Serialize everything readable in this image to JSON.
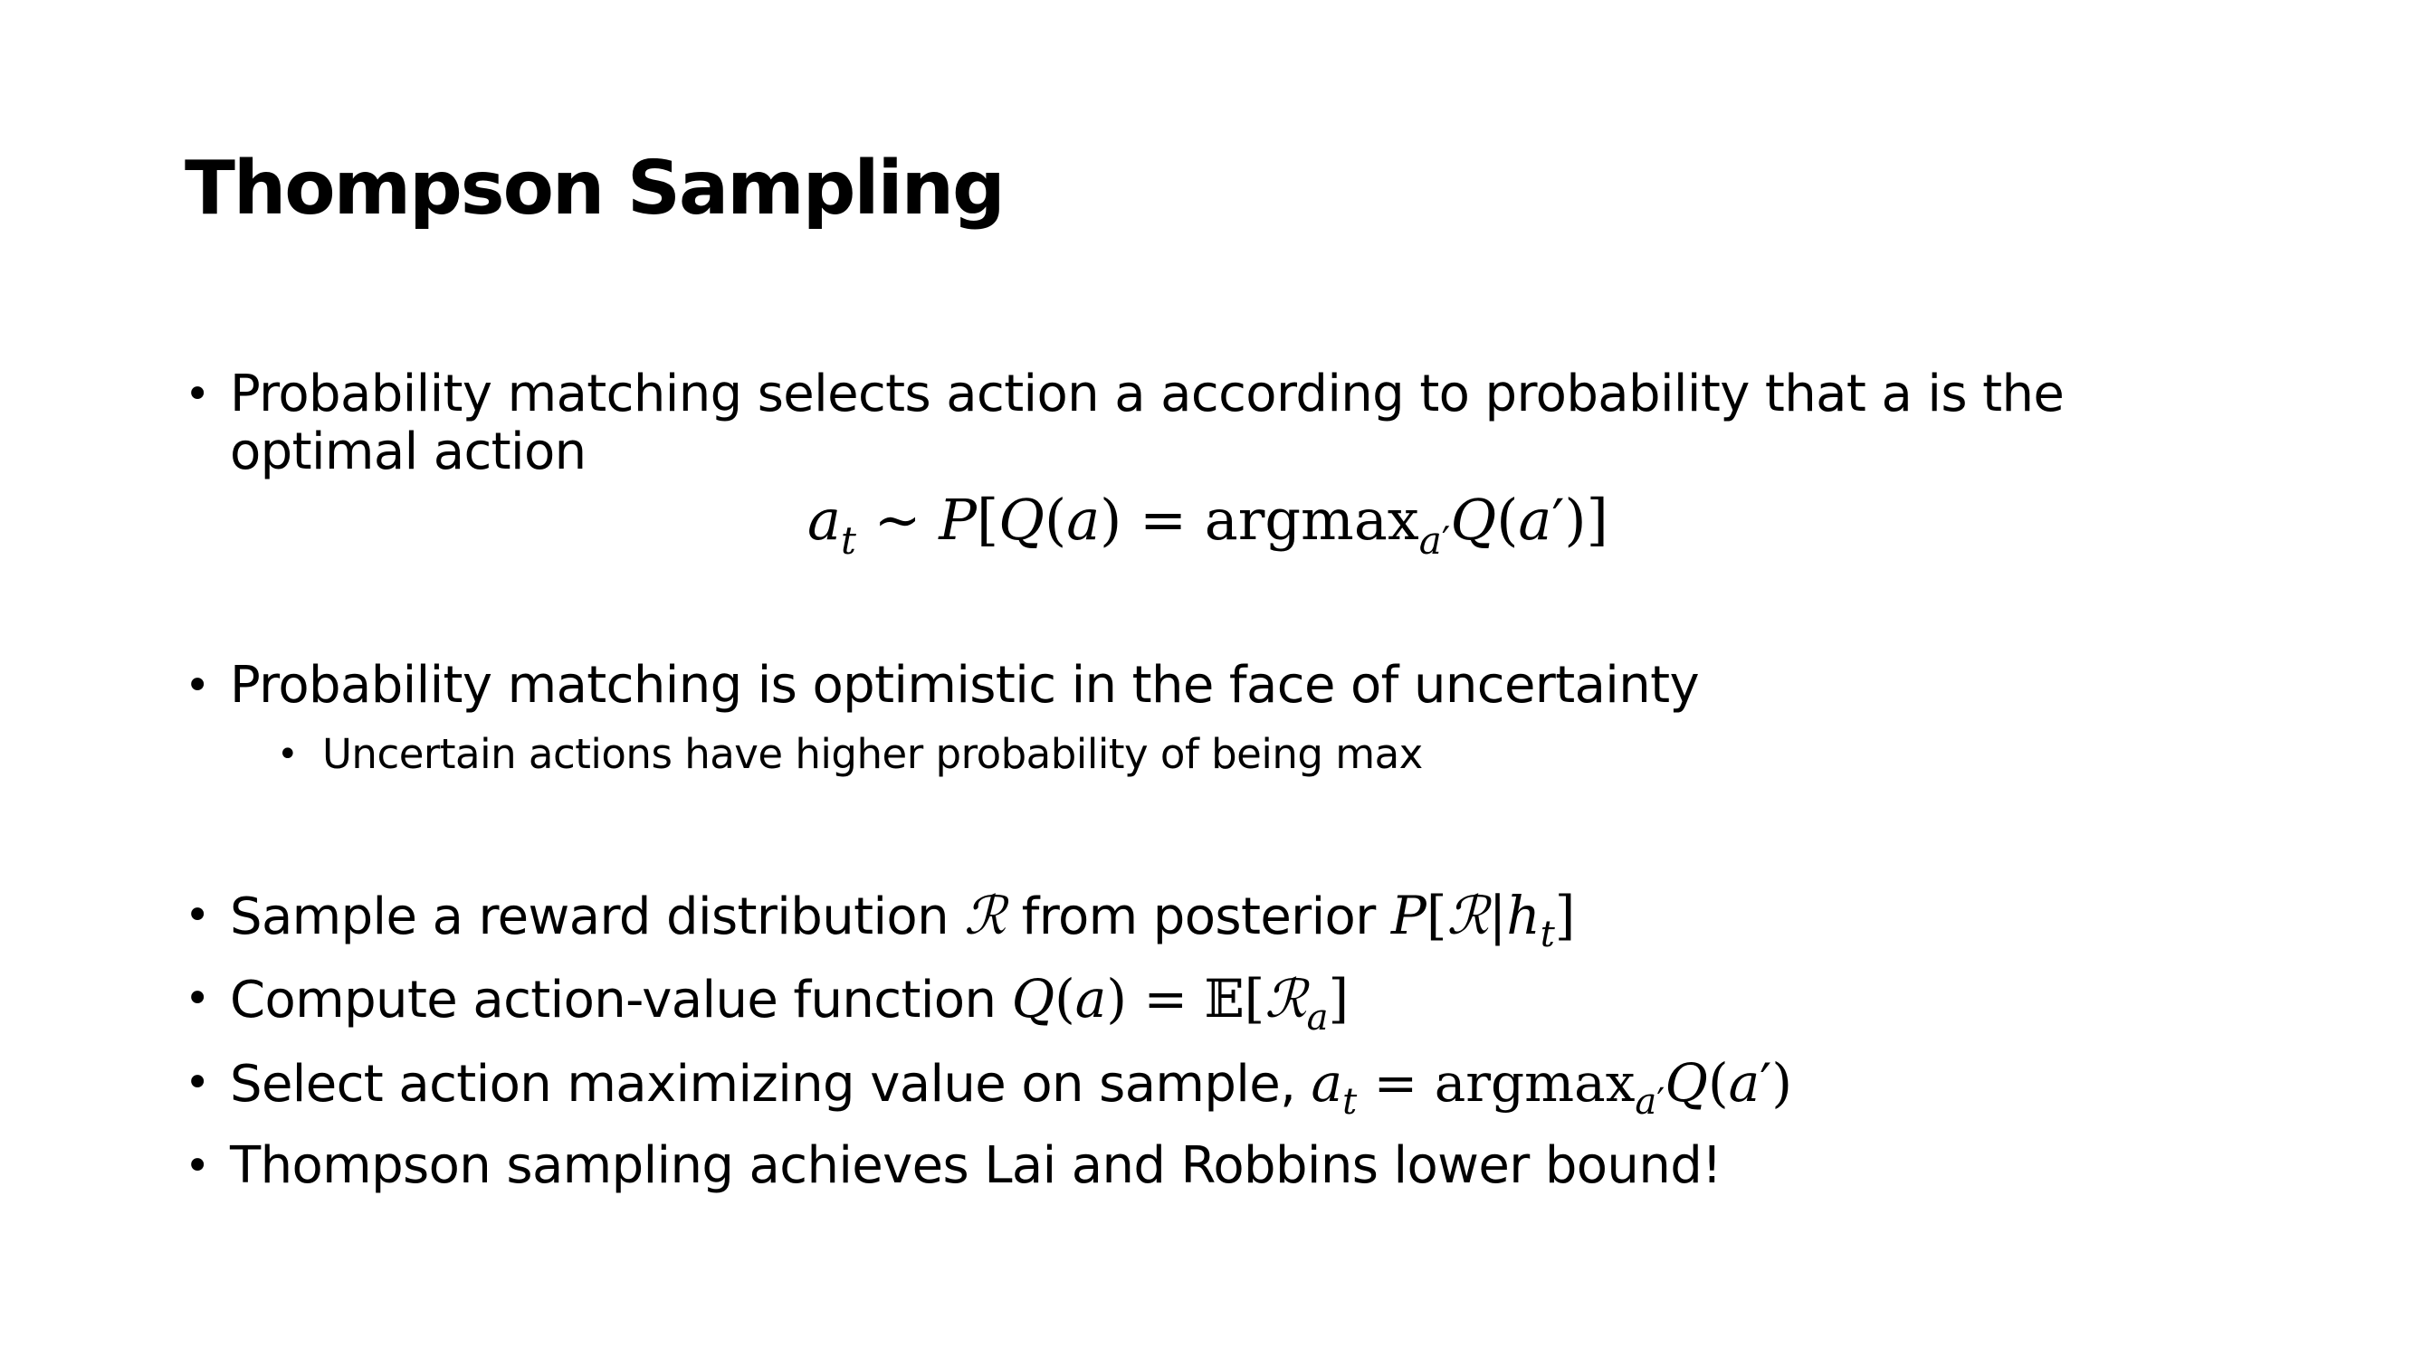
{
  "slide": {
    "title": "Thompson Sampling",
    "bullets": [
      {
        "id": "b1",
        "text": "Probability matching selects action a according to probability that a is the optimal action"
      },
      {
        "id": "b2",
        "text": "Probability matching is optimistic in the face of uncertainty",
        "sub": "Uncertain actions have higher probability of being max"
      },
      {
        "id": "b3",
        "text": "Sample a reward distribution ",
        "mid": " from posterior "
      },
      {
        "id": "b4",
        "text": "Compute action-value function "
      },
      {
        "id": "b5",
        "text": "Select action maximizing value on sample, "
      },
      {
        "id": "b6",
        "text": "Thompson sampling achieves Lai and Robbins lower bound!"
      }
    ],
    "bullet_glyph": "•",
    "math": {
      "argmax": "argmax"
    }
  }
}
